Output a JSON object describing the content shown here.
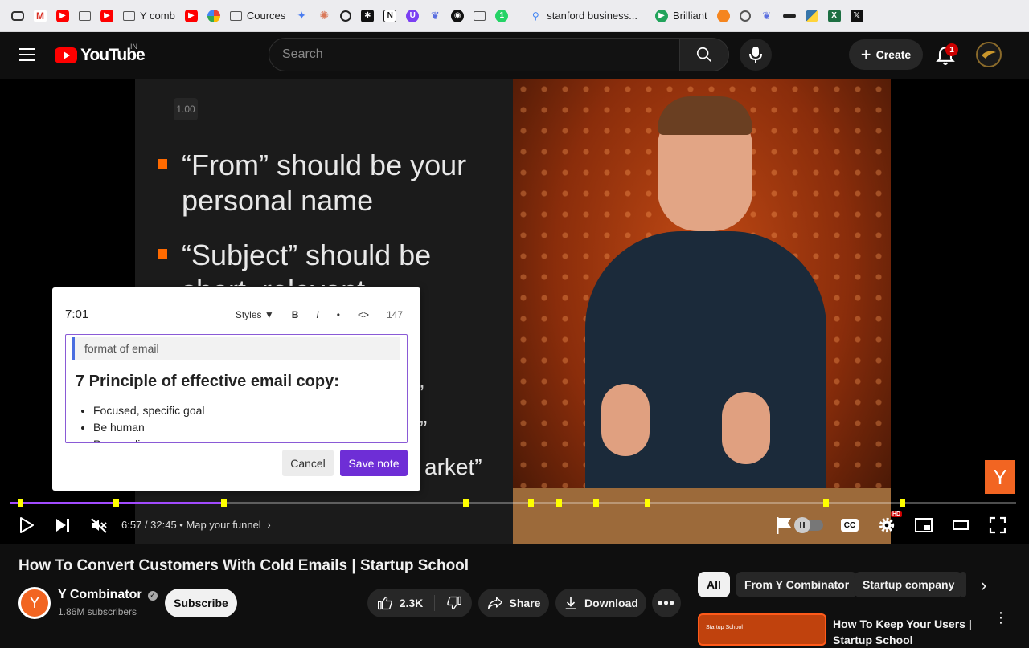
{
  "bookmarks": [
    {
      "label": "",
      "icon": "tabs-icon"
    },
    {
      "label": "",
      "icon": "gmail-icon"
    },
    {
      "label": "",
      "icon": "youtube-icon"
    },
    {
      "label": "",
      "icon": "folder-icon"
    },
    {
      "label": "",
      "icon": "youtube-icon"
    },
    {
      "label": "Y comb",
      "icon": "folder-icon"
    },
    {
      "label": "",
      "icon": "youtube-icon"
    },
    {
      "label": "",
      "icon": "photos-icon"
    },
    {
      "label": "Cources",
      "icon": "folder-icon"
    },
    {
      "label": "",
      "icon": "gemini-icon"
    },
    {
      "label": "",
      "icon": "claude-icon"
    },
    {
      "label": "",
      "icon": "chatgpt-icon"
    },
    {
      "label": "",
      "icon": "perplexity-icon"
    },
    {
      "label": "",
      "icon": "notion-icon"
    },
    {
      "label": "",
      "icon": "app-icon"
    },
    {
      "label": "",
      "icon": "bird-icon"
    },
    {
      "label": "",
      "icon": "github-icon"
    },
    {
      "label": "",
      "icon": "folder-icon"
    },
    {
      "label": "",
      "icon": "whatsapp-icon"
    },
    {
      "label": "stanford business...",
      "icon": "search-icon"
    },
    {
      "label": "Brilliant",
      "icon": "brilliant-icon"
    },
    {
      "label": "",
      "icon": "app-icon"
    },
    {
      "label": "",
      "icon": "app-icon"
    },
    {
      "label": "",
      "icon": "bird-icon"
    },
    {
      "label": "",
      "icon": "app-icon"
    },
    {
      "label": "",
      "icon": "python-icon"
    },
    {
      "label": "",
      "icon": "excel-icon"
    },
    {
      "label": "",
      "icon": "x-icon"
    }
  ],
  "header": {
    "logo": "YouTube",
    "region": "IN",
    "search_placeholder": "Search",
    "create_label": "Create",
    "notification_count": "1"
  },
  "slide": {
    "slide_number": "1.00",
    "bullet1": "“From” should be your personal name",
    "bullet2": "“Subject” should be short, relevant",
    "frag1": "”",
    "frag2": "”",
    "frag3": "arket”"
  },
  "note": {
    "timestamp": "7:01",
    "toolbar": {
      "styles": "Styles ▼",
      "bold": "B",
      "italic": "I",
      "bullet": "•",
      "code": "<>",
      "count": "147"
    },
    "quote": "format of email",
    "heading": "7 Principle of effective email copy:",
    "items": [
      "Focused, specific goal",
      "Be human",
      "Personalize"
    ],
    "cancel_label": "Cancel",
    "save_label": "Save note"
  },
  "player": {
    "time": "6:57 / 32:45",
    "chapter": "Map your funnel",
    "progress": 0.2127,
    "watermark": "Y",
    "hd_badge": "HD"
  },
  "video": {
    "title": "How To Convert Customers With Cold Emails | Startup School",
    "channel": "Y Combinator",
    "channel_avatar": "Y",
    "subscribers": "1.86M subscribers",
    "subscribe_label": "Subscribe",
    "likes": "2.3K",
    "share_label": "Share",
    "download_label": "Download"
  },
  "chips": [
    "All",
    "From Y Combinator",
    "Startup company"
  ],
  "recommendation": {
    "title": "How To Keep Your Users | Startup School",
    "thumb_label": "Startup School"
  }
}
